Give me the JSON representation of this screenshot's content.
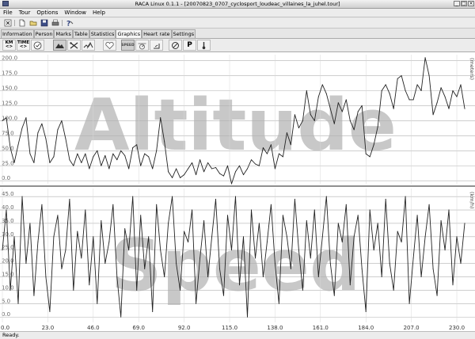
{
  "window": {
    "title": "RACA Linux 0.1.1 - [20070823_0707_cyclosport_loudeac_villaines_la_juhel.tour]"
  },
  "menu": {
    "items": [
      "File",
      "Tour",
      "Options",
      "Window",
      "Help"
    ]
  },
  "toolbar": {
    "icons": [
      "close-doc-icon",
      "new-doc-icon",
      "open-folder-icon",
      "save-icon",
      "print-icon",
      "help-icon"
    ]
  },
  "tabs": {
    "items": [
      "Information",
      "Person",
      "Marks",
      "Table",
      "Statistics",
      "Graphics",
      "Heart rate",
      "Settings"
    ],
    "active": "Graphics"
  },
  "graph_toolbar": {
    "km_label": "KM",
    "time_label": "TIME",
    "speed_label": "SPEED",
    "p_label": "P"
  },
  "status": {
    "text": "Ready."
  },
  "chart_data": [
    {
      "type": "line",
      "title": "Altitude",
      "x_ticks": [
        "0.0",
        "23.0",
        "46.0",
        "69.0",
        "92.0",
        "115.0",
        "138.0",
        "161.0",
        "184.0",
        "207.0",
        "230.0"
      ],
      "y_ticks": [
        "0.0",
        "25.0",
        "50.0",
        "75.0",
        "100.0",
        "125.0",
        "150.0",
        "175.0",
        "200.0"
      ],
      "ylim": [
        -5,
        210
      ],
      "xlim": [
        0,
        236
      ],
      "right_label": "(meters)",
      "grid": true,
      "x": [
        0,
        2,
        4,
        6,
        8,
        10,
        12,
        14,
        16,
        18,
        20,
        22,
        24,
        26,
        28,
        30,
        32,
        34,
        36,
        38,
        40,
        42,
        44,
        46,
        48,
        50,
        52,
        54,
        56,
        58,
        60,
        62,
        64,
        66,
        68,
        70,
        72,
        74,
        76,
        78,
        80,
        82,
        84,
        86,
        88,
        90,
        92,
        94,
        96,
        98,
        100,
        102,
        104,
        106,
        108,
        110,
        112,
        114,
        116,
        118,
        120,
        122,
        124,
        126,
        128,
        130,
        132,
        134,
        136,
        138,
        140,
        142,
        144,
        146,
        148,
        150,
        152,
        154,
        156,
        158,
        160,
        162,
        164,
        166,
        168,
        170,
        172,
        174,
        176,
        178,
        180,
        182,
        184,
        186,
        188,
        190,
        192,
        194,
        196,
        198,
        200,
        202,
        204,
        206,
        208,
        210,
        212,
        214,
        216,
        218,
        220,
        222,
        224,
        226,
        228,
        230,
        232,
        234
      ],
      "y": [
        100,
        105,
        55,
        30,
        60,
        88,
        105,
        45,
        30,
        80,
        95,
        70,
        30,
        40,
        85,
        100,
        70,
        35,
        25,
        45,
        30,
        45,
        20,
        40,
        50,
        25,
        42,
        20,
        45,
        35,
        50,
        42,
        20,
        55,
        60,
        25,
        45,
        40,
        20,
        50,
        105,
        65,
        15,
        5,
        20,
        5,
        10,
        20,
        30,
        10,
        35,
        15,
        30,
        20,
        22,
        12,
        8,
        25,
        -5,
        15,
        25,
        10,
        20,
        35,
        28,
        25,
        55,
        45,
        60,
        20,
        45,
        40,
        80,
        60,
        110,
        88,
        100,
        150,
        110,
        100,
        140,
        160,
        145,
        120,
        95,
        130,
        115,
        135,
        100,
        85,
        115,
        125,
        45,
        40,
        60,
        90,
        150,
        160,
        145,
        120,
        170,
        175,
        150,
        135,
        135,
        160,
        150,
        205,
        175,
        110,
        130,
        155,
        140,
        120,
        150,
        140,
        160,
        120
      ]
    },
    {
      "type": "line",
      "title": "Speed",
      "x_ticks": [
        "0.0",
        "23.0",
        "46.0",
        "69.0",
        "92.0",
        "115.0",
        "138.0",
        "161.0",
        "184.0",
        "207.0",
        "230.0"
      ],
      "y_ticks": [
        "0.0",
        "5.0",
        "10.0",
        "15.0",
        "20.0",
        "25.0",
        "30.0",
        "35.0",
        "40.0",
        "45.0"
      ],
      "ylim": [
        -2,
        48
      ],
      "xlim": [
        0,
        236
      ],
      "right_label": "(km/h)",
      "grid": true,
      "x": [
        0,
        2,
        4,
        6,
        8,
        10,
        12,
        14,
        16,
        18,
        20,
        22,
        24,
        26,
        28,
        30,
        32,
        34,
        36,
        38,
        40,
        42,
        44,
        46,
        48,
        50,
        52,
        54,
        56,
        58,
        60,
        62,
        64,
        66,
        68,
        70,
        72,
        74,
        76,
        78,
        80,
        82,
        84,
        86,
        88,
        90,
        92,
        94,
        96,
        98,
        100,
        102,
        104,
        106,
        108,
        110,
        112,
        114,
        116,
        118,
        120,
        122,
        124,
        126,
        128,
        130,
        132,
        134,
        136,
        138,
        140,
        142,
        144,
        146,
        148,
        150,
        152,
        154,
        156,
        158,
        160,
        162,
        164,
        166,
        168,
        170,
        172,
        174,
        176,
        178,
        180,
        182,
        184,
        186,
        188,
        190,
        192,
        194,
        196,
        198,
        200,
        202,
        204,
        206,
        208,
        210,
        212,
        214,
        216,
        218,
        220,
        222,
        224,
        226,
        228,
        230,
        232,
        234
      ],
      "y": [
        25,
        40,
        10,
        30,
        5,
        45,
        20,
        35,
        8,
        28,
        42,
        15,
        2,
        30,
        38,
        18,
        25,
        44,
        10,
        32,
        22,
        40,
        12,
        30,
        5,
        36,
        20,
        28,
        42,
        15,
        0,
        33,
        25,
        45,
        10,
        38,
        18,
        30,
        2,
        42,
        25,
        15,
        35,
        45,
        20,
        10,
        32,
        28,
        40,
        5,
        22,
        36,
        15,
        30,
        44,
        18,
        8,
        38,
        25,
        45,
        12,
        30,
        0,
        40,
        22,
        35,
        15,
        28,
        42,
        20,
        5,
        38,
        30,
        18,
        44,
        25,
        10,
        36,
        22,
        40,
        15,
        30,
        45,
        20,
        8,
        35,
        28,
        42,
        12,
        30,
        38,
        18,
        2,
        40,
        25,
        35,
        15,
        44,
        20,
        10,
        32,
        28,
        45,
        5,
        22,
        38,
        15,
        30,
        42,
        18,
        8,
        36,
        25,
        40,
        12,
        30,
        20,
        35
      ]
    }
  ]
}
